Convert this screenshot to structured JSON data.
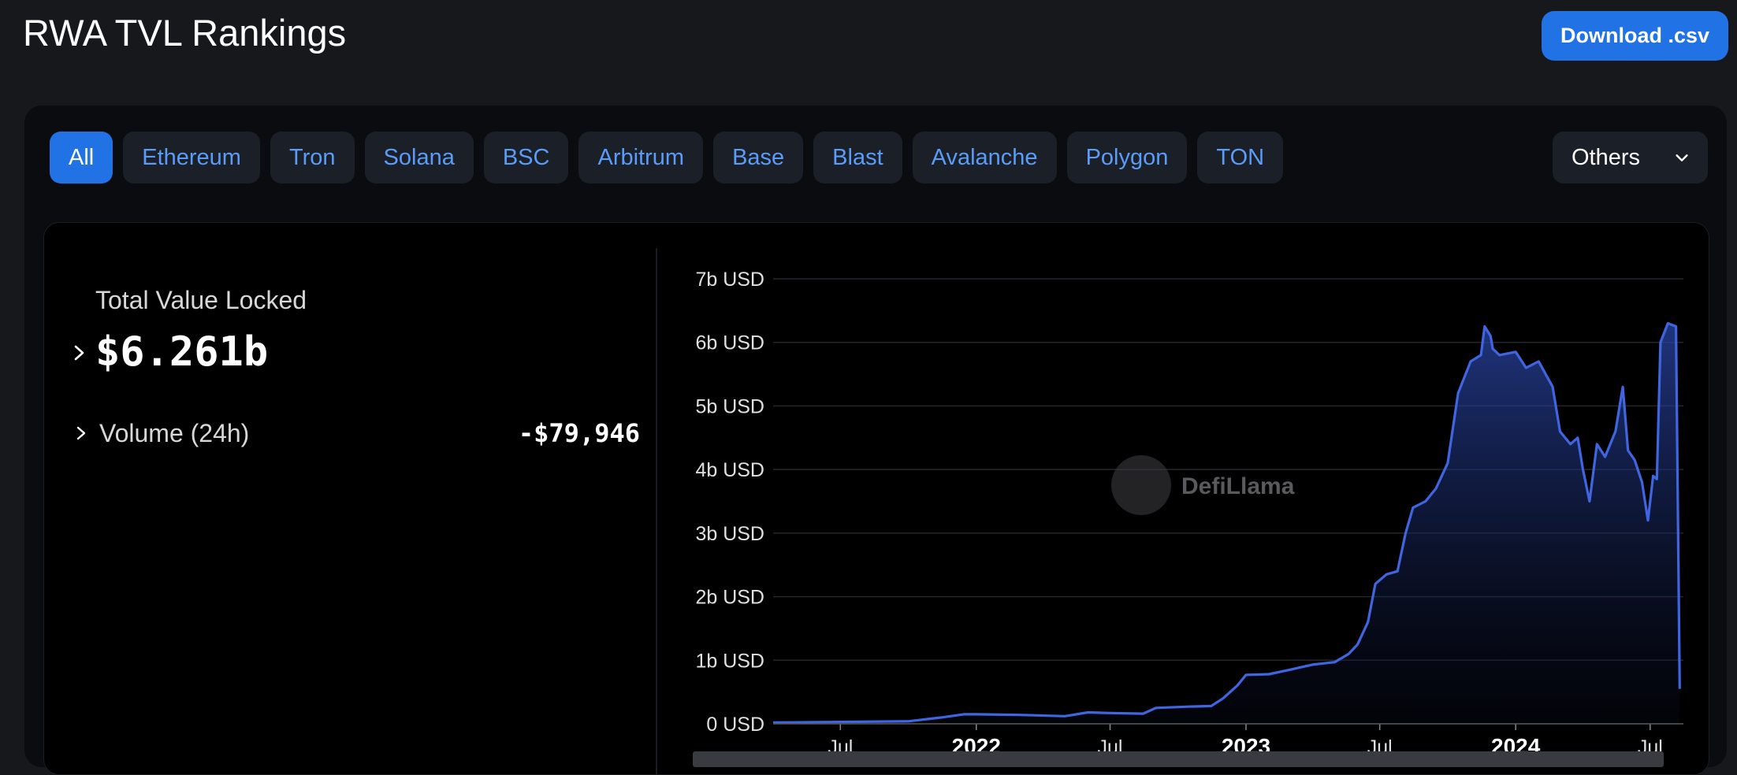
{
  "header": {
    "title": "RWA TVL Rankings",
    "download_label": "Download .csv"
  },
  "chains": [
    {
      "label": "All",
      "active": true
    },
    {
      "label": "Ethereum",
      "active": false
    },
    {
      "label": "Tron",
      "active": false
    },
    {
      "label": "Solana",
      "active": false
    },
    {
      "label": "BSC",
      "active": false
    },
    {
      "label": "Arbitrum",
      "active": false
    },
    {
      "label": "Base",
      "active": false
    },
    {
      "label": "Blast",
      "active": false
    },
    {
      "label": "Avalanche",
      "active": false
    },
    {
      "label": "Polygon",
      "active": false
    },
    {
      "label": "TON",
      "active": false
    }
  ],
  "others": {
    "label": "Others",
    "icon": "chevron-down-icon"
  },
  "stats": {
    "tvl_label": "Total Value Locked",
    "tvl_value": "$6.261b",
    "volume_label": "Volume (24h)",
    "volume_value": "-$79,946"
  },
  "watermark": {
    "text": "DefiLlama",
    "icon": "llama-logo-icon"
  },
  "colors": {
    "accent": "#2172e5",
    "line": "#3f66e0",
    "chain_text": "#5a9cf7"
  },
  "chart_data": {
    "type": "area",
    "x_type": "date",
    "ylabel": "",
    "xlabel": "",
    "ylim": [
      0,
      7
    ],
    "unit": "b USD",
    "y_ticks": [
      "0 USD",
      "1b USD",
      "2b USD",
      "3b USD",
      "4b USD",
      "5b USD",
      "6b USD",
      "7b USD"
    ],
    "x_ticks": [
      {
        "label": "Jul",
        "date": "2021-07-01",
        "major": false
      },
      {
        "label": "2022",
        "date": "2022-01-01",
        "major": true
      },
      {
        "label": "Jul",
        "date": "2022-07-01",
        "major": false
      },
      {
        "label": "2023",
        "date": "2023-01-01",
        "major": true
      },
      {
        "label": "Jul",
        "date": "2023-07-01",
        "major": false
      },
      {
        "label": "2024",
        "date": "2024-01-01",
        "major": true
      },
      {
        "label": "Jul",
        "date": "2024-07-01",
        "major": false
      }
    ],
    "x_range": [
      "2021-04-01",
      "2024-08-15"
    ],
    "grid": true,
    "series": [
      {
        "points": [
          [
            "2021-04-01",
            0.02
          ],
          [
            "2021-07-01",
            0.03
          ],
          [
            "2021-10-01",
            0.04
          ],
          [
            "2021-11-15",
            0.1
          ],
          [
            "2021-12-15",
            0.15
          ],
          [
            "2022-01-01",
            0.15
          ],
          [
            "2022-03-01",
            0.14
          ],
          [
            "2022-05-01",
            0.12
          ],
          [
            "2022-06-01",
            0.18
          ],
          [
            "2022-07-01",
            0.17
          ],
          [
            "2022-08-15",
            0.16
          ],
          [
            "2022-09-01",
            0.25
          ],
          [
            "2022-10-15",
            0.27
          ],
          [
            "2022-11-15",
            0.28
          ],
          [
            "2022-12-01",
            0.4
          ],
          [
            "2022-12-20",
            0.6
          ],
          [
            "2023-01-01",
            0.77
          ],
          [
            "2023-02-01",
            0.78
          ],
          [
            "2023-03-01",
            0.85
          ],
          [
            "2023-04-01",
            0.93
          ],
          [
            "2023-05-01",
            0.97
          ],
          [
            "2023-05-20",
            1.1
          ],
          [
            "2023-06-01",
            1.25
          ],
          [
            "2023-06-15",
            1.6
          ],
          [
            "2023-06-25",
            2.2
          ],
          [
            "2023-07-10",
            2.35
          ],
          [
            "2023-07-25",
            2.4
          ],
          [
            "2023-08-05",
            3.0
          ],
          [
            "2023-08-15",
            3.4
          ],
          [
            "2023-09-01",
            3.5
          ],
          [
            "2023-09-15",
            3.7
          ],
          [
            "2023-10-01",
            4.1
          ],
          [
            "2023-10-15",
            5.2
          ],
          [
            "2023-11-01",
            5.7
          ],
          [
            "2023-11-15",
            5.8
          ],
          [
            "2023-11-20",
            6.25
          ],
          [
            "2023-11-28",
            6.1
          ],
          [
            "2023-12-01",
            5.9
          ],
          [
            "2023-12-10",
            5.8
          ],
          [
            "2024-01-01",
            5.85
          ],
          [
            "2024-01-15",
            5.6
          ],
          [
            "2024-02-01",
            5.7
          ],
          [
            "2024-02-20",
            5.3
          ],
          [
            "2024-03-01",
            4.6
          ],
          [
            "2024-03-15",
            4.4
          ],
          [
            "2024-03-25",
            4.5
          ],
          [
            "2024-04-01",
            4.0
          ],
          [
            "2024-04-10",
            3.5
          ],
          [
            "2024-04-20",
            4.4
          ],
          [
            "2024-05-01",
            4.2
          ],
          [
            "2024-05-15",
            4.6
          ],
          [
            "2024-05-25",
            5.3
          ],
          [
            "2024-06-01",
            4.3
          ],
          [
            "2024-06-10",
            4.15
          ],
          [
            "2024-06-20",
            3.8
          ],
          [
            "2024-06-28",
            3.2
          ],
          [
            "2024-07-05",
            3.9
          ],
          [
            "2024-07-10",
            3.85
          ],
          [
            "2024-07-15",
            6.0
          ],
          [
            "2024-07-25",
            6.3
          ],
          [
            "2024-08-05",
            6.25
          ],
          [
            "2024-08-10",
            0.55
          ]
        ]
      }
    ]
  }
}
